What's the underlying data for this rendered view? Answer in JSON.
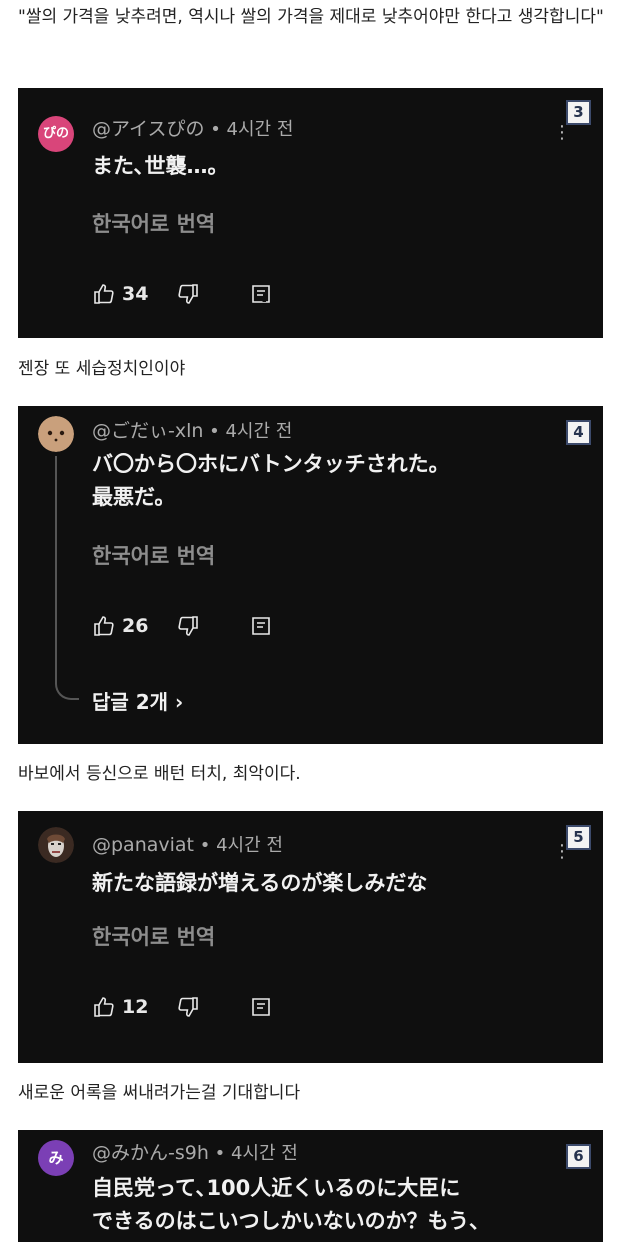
{
  "captions": [
    "\"쌀의 가격을 낮추려면, 역시나 쌀의 가격을 제대로 낮추어야만 한다고 생각합니다\"",
    "젠장 또 세습정치인이야",
    "바보에서 등신으로 배턴 터치, 최악이다.",
    "새로운 어록을 써내려가는걸 기대합니다"
  ],
  "comments": [
    {
      "badge": "3",
      "avatar_text": "ぴの",
      "avatar_color": "#d9457a",
      "handle": "@アイスぴの",
      "time": " • 4시간 전",
      "lines": [
        "また､世襲…。"
      ],
      "translate": "한국어로 번역",
      "likes": "34"
    },
    {
      "badge": "4",
      "avatar_text": "",
      "avatar_color": "#c9a07c",
      "handle": "@ごだぃ-xln",
      "time": " • 4시간 전",
      "lines": [
        "バ〇から〇ホにバトンタッチされた。",
        "最悪だ。"
      ],
      "translate": "한국어로 번역",
      "likes": "26",
      "replies": "답글 2개 ›"
    },
    {
      "badge": "5",
      "avatar_text": "",
      "avatar_color": "#6e4a36",
      "handle": "@panaviat",
      "time": " • 4시간 전",
      "lines": [
        "新たな語録が増えるのが楽しみだな"
      ],
      "translate": "한국어로 번역",
      "likes": "12"
    },
    {
      "badge": "6",
      "avatar_text": "み",
      "avatar_color": "#7b3fb5",
      "handle": "@みかん-s9h",
      "time": " • 4시간 전",
      "lines": [
        "自民党って､100人近くいるのに大臣に",
        "できるのはこいつしかいないのか？もう、"
      ]
    }
  ],
  "icons": {
    "like": "thumbs-up-icon",
    "dislike": "thumbs-down-icon",
    "reply": "reply-comment-icon",
    "more": "more-vert-icon"
  }
}
